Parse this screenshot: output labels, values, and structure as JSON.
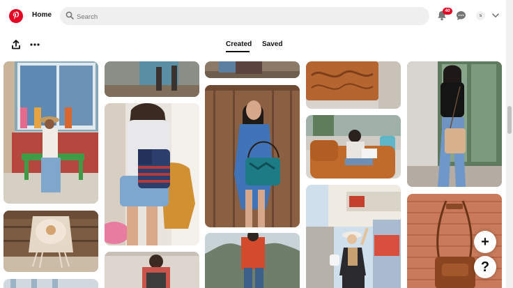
{
  "header": {
    "home_label": "Home",
    "search_placeholder": "Search",
    "notification_count": "40",
    "avatar_initial": "s"
  },
  "tabs": [
    {
      "label": "Created",
      "selected": true
    },
    {
      "label": "Saved",
      "selected": false
    }
  ],
  "fab": {
    "add_label": "+",
    "help_label": "?"
  },
  "icons": [
    "pinterest-logo-icon",
    "search-icon",
    "bell-icon",
    "chat-icon",
    "chevron-down-icon",
    "share-icon",
    "more-icon"
  ],
  "colors": {
    "brand": "#e60023",
    "search_bg": "#efefef",
    "text": "#111111"
  }
}
